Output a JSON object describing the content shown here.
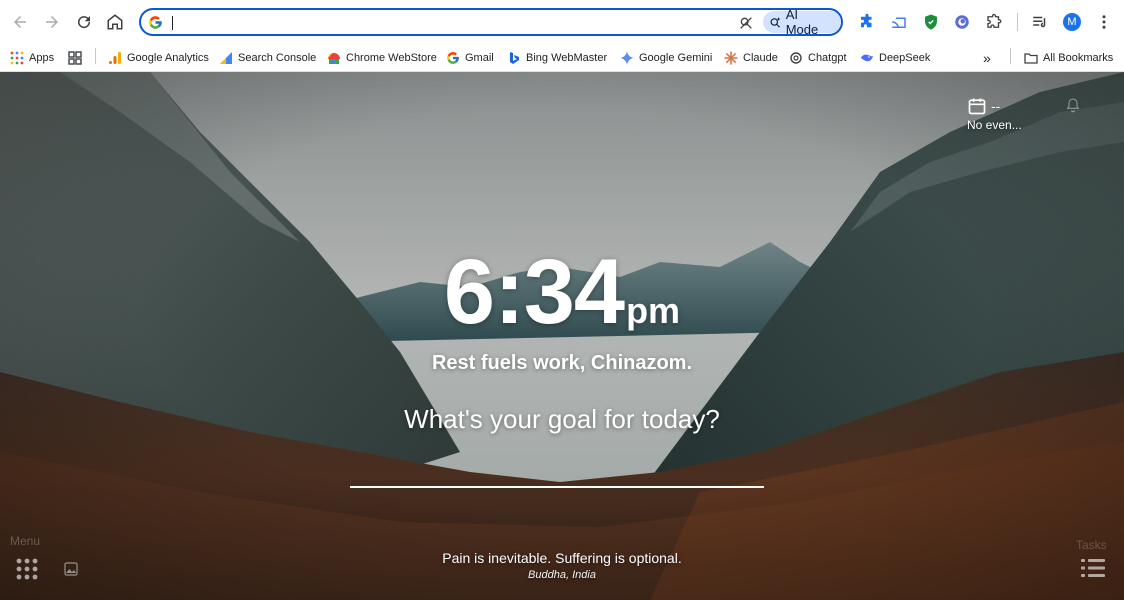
{
  "browser": {
    "address_value": "",
    "ai_mode_label": "AI Mode",
    "profile_initial": "M",
    "accent_color": "#0b57d0",
    "icons": [
      "back-icon",
      "forward-icon",
      "reload-icon",
      "home-icon",
      "google-g-icon",
      "lens-icon",
      "ai-mode-icon",
      "puzzle-extension-icon",
      "cast-icon",
      "shield-icon",
      "circle-extension-icon",
      "extensions-icon",
      "reading-list-icon",
      "more-menu-icon"
    ]
  },
  "bookmarks": {
    "items": [
      {
        "label": "Apps",
        "icon": "apps-grid-icon"
      },
      {
        "label": "",
        "icon": "grid-squares-icon"
      },
      {
        "label": "Google Analytics",
        "icon": "analytics-icon"
      },
      {
        "label": "Search Console",
        "icon": "search-console-icon"
      },
      {
        "label": "Chrome WebStore",
        "icon": "webstore-icon"
      },
      {
        "label": "Gmail",
        "icon": "google-g-icon"
      },
      {
        "label": "Bing WebMaster",
        "icon": "bing-icon"
      },
      {
        "label": "Google Gemini",
        "icon": "gemini-icon"
      },
      {
        "label": "Claude",
        "icon": "claude-icon"
      },
      {
        "label": "Chatgpt",
        "icon": "chatgpt-icon"
      },
      {
        "label": "DeepSeek",
        "icon": "deepseek-icon"
      }
    ],
    "overflow": "»",
    "all_bookmarks": "All Bookmarks"
  },
  "dashboard": {
    "time": "6:34",
    "ampm": "pm",
    "greeting": "Rest fuels work, Chinazom.",
    "question": "What's your goal for today?",
    "goal_value": "",
    "calendar_dash": "--",
    "calendar_status": "No even...",
    "menu_label": "Menu",
    "tasks_label": "Tasks",
    "quote": "Pain is inevitable. Suffering is optional.",
    "quote_source": "Buddha, India"
  }
}
